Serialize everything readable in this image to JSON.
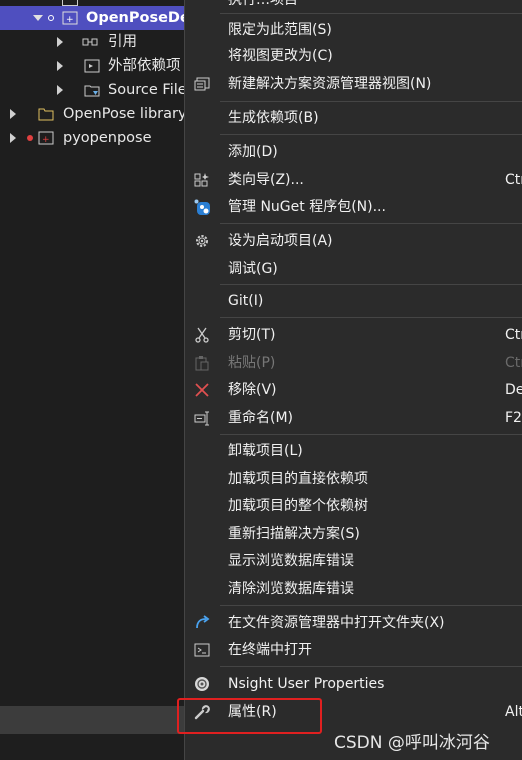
{
  "explorer": {
    "rows": [
      {
        "label": "OpenPoseDe",
        "selected": true
      },
      {
        "label": "引用"
      },
      {
        "label": "外部依赖项"
      },
      {
        "label": "Source File"
      },
      {
        "label": "OpenPose library"
      },
      {
        "label": "pyopenpose"
      }
    ]
  },
  "menu": {
    "top_partial": "执行…项目",
    "items": [
      {
        "label": "限定为此范围(S)"
      },
      {
        "label": "将视图更改为(C)"
      },
      {
        "label": "新建解决方案资源管理器视图(N)",
        "icon": "new-view-icon"
      },
      {
        "label": "生成依赖项(B)"
      },
      {
        "label": "添加(D)"
      },
      {
        "label": "类向导(Z)...",
        "shortcut": "Ctr",
        "icon": "class-wizard-icon"
      },
      {
        "label": "管理 NuGet 程序包(N)...",
        "icon": "nuget-icon"
      },
      {
        "label": "设为启动项目(A)",
        "icon": "gear-icon"
      },
      {
        "label": "调试(G)"
      },
      {
        "label": "Git(I)"
      },
      {
        "label": "剪切(T)",
        "shortcut": "Ctr",
        "icon": "scissors-icon"
      },
      {
        "label": "粘贴(P)",
        "shortcut": "Ctr",
        "icon": "paste-icon",
        "disabled": true
      },
      {
        "label": "移除(V)",
        "shortcut": "De",
        "icon": "remove-x-icon"
      },
      {
        "label": "重命名(M)",
        "shortcut": "F2",
        "icon": "rename-icon"
      },
      {
        "label": "卸载项目(L)"
      },
      {
        "label": "加载项目的直接依赖项"
      },
      {
        "label": "加载项目的整个依赖树"
      },
      {
        "label": "重新扫描解决方案(S)"
      },
      {
        "label": "显示浏览数据库错误"
      },
      {
        "label": "清除浏览数据库错误"
      },
      {
        "label": "在文件资源管理器中打开文件夹(X)",
        "icon": "open-folder-arrow-icon"
      },
      {
        "label": "在终端中打开",
        "icon": "terminal-icon"
      },
      {
        "label": "Nsight User Properties",
        "icon": "nsight-icon"
      },
      {
        "label": "属性(R)",
        "shortcut": "Alt",
        "icon": "wrench-icon"
      }
    ]
  },
  "watermark": "CSDN @呼叫冰河谷",
  "colors": {
    "selection": "#4f4fbf",
    "menu_bg": "#2b2b2b",
    "highlight": "#e02020"
  }
}
